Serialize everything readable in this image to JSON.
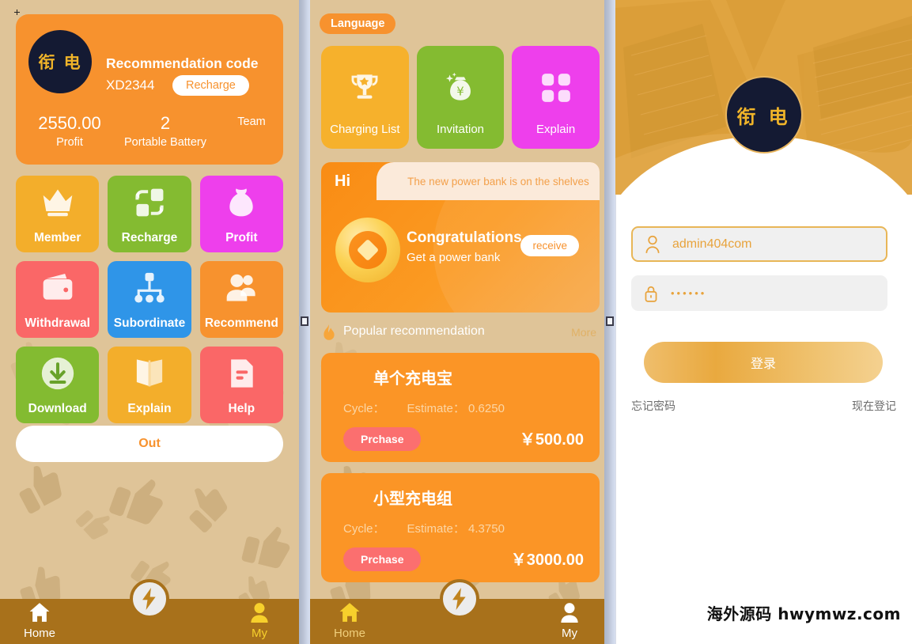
{
  "left_panel": {
    "profile": {
      "logo_text": "衔 电",
      "rec_title": "Recommendation code",
      "rec_code": "XD2344",
      "recharge_label": "Recharge",
      "stats": [
        {
          "value": "2550.00",
          "label": "Profit"
        },
        {
          "value": "2",
          "label": "Portable Battery"
        },
        {
          "value": "",
          "label": "Team"
        }
      ]
    },
    "menu": [
      {
        "label": "Member",
        "icon": "crown-icon",
        "color": "#f3ae2b"
      },
      {
        "label": "Recharge",
        "icon": "exchange-icon",
        "color": "#84bb31"
      },
      {
        "label": "Profit",
        "icon": "money-bag-icon",
        "color": "#ee3fec"
      },
      {
        "label": "Withdrawal",
        "icon": "wallet-icon",
        "color": "#fa6767"
      },
      {
        "label": "Subordinate",
        "icon": "hierarchy-icon",
        "color": "#2f95e8"
      },
      {
        "label": "Recommend",
        "icon": "users-icon",
        "color": "#f7922e"
      },
      {
        "label": "Download",
        "icon": "download-icon",
        "color": "#83bb31"
      },
      {
        "label": "Explain",
        "icon": "open-book-icon",
        "color": "#f3ae2b"
      },
      {
        "label": "Help",
        "icon": "document-icon",
        "color": "#fa6767"
      }
    ],
    "out_label": "Out",
    "tabs": [
      {
        "label": "Home",
        "icon": "home-icon",
        "active": false
      },
      {
        "label": "My",
        "icon": "user-icon",
        "active": true
      }
    ],
    "fab_icon": "lightning-bolt-icon"
  },
  "mid_panel": {
    "language_label": "Language",
    "menu": [
      {
        "label": "Charging List",
        "icon": "trophy-icon",
        "color": "#f6b12c"
      },
      {
        "label": "Invitation",
        "icon": "money-bag-icon",
        "color": "#84bb31"
      },
      {
        "label": "Explain",
        "icon": "grid-icon",
        "color": "#ee3fec"
      }
    ],
    "banner": {
      "hi": "Hi",
      "marquee": "The new power bank is on the shelves",
      "title": "Congratulations",
      "subtitle": "Get a power bank",
      "button": "receive"
    },
    "popular": {
      "title": "Popular recommendation",
      "more": "More",
      "fire_icon": "flame-icon"
    },
    "products": [
      {
        "name": "单个充电宝",
        "cycle_label": "Cycle：",
        "estimate_label": "Estimate：",
        "estimate": "0.6250",
        "buy": "Prchase",
        "price": "￥500.00"
      },
      {
        "name": "小型充电组",
        "cycle_label": "Cycle：",
        "estimate_label": "Estimate：",
        "estimate": "4.3750",
        "buy": "Prchase",
        "price": "￥3000.00"
      }
    ],
    "tabs": [
      {
        "label": "Home",
        "icon": "home-icon",
        "active": true
      },
      {
        "label": "My",
        "icon": "user-icon",
        "active": false
      }
    ],
    "fab_icon": "lightning-bolt-icon"
  },
  "right_panel": {
    "logo_text": "衔 电",
    "username": {
      "value": "admin404com",
      "placeholder": "admin404com",
      "icon": "person-icon"
    },
    "password": {
      "value": "••••••",
      "placeholder": "",
      "icon": "lock-icon"
    },
    "login_label": "登录",
    "forgot_label": "忘记密码",
    "register_label": "现在登记",
    "watermark": "海外源码 hwymwz.com"
  },
  "colors": {
    "background_tan": "#dfc498",
    "accent_orange": "#f7922e",
    "tabbar_brown": "#a8711b",
    "hero_orange": "#e0a440",
    "dark_navy": "#141a33",
    "logo_gold": "#f0b429"
  }
}
